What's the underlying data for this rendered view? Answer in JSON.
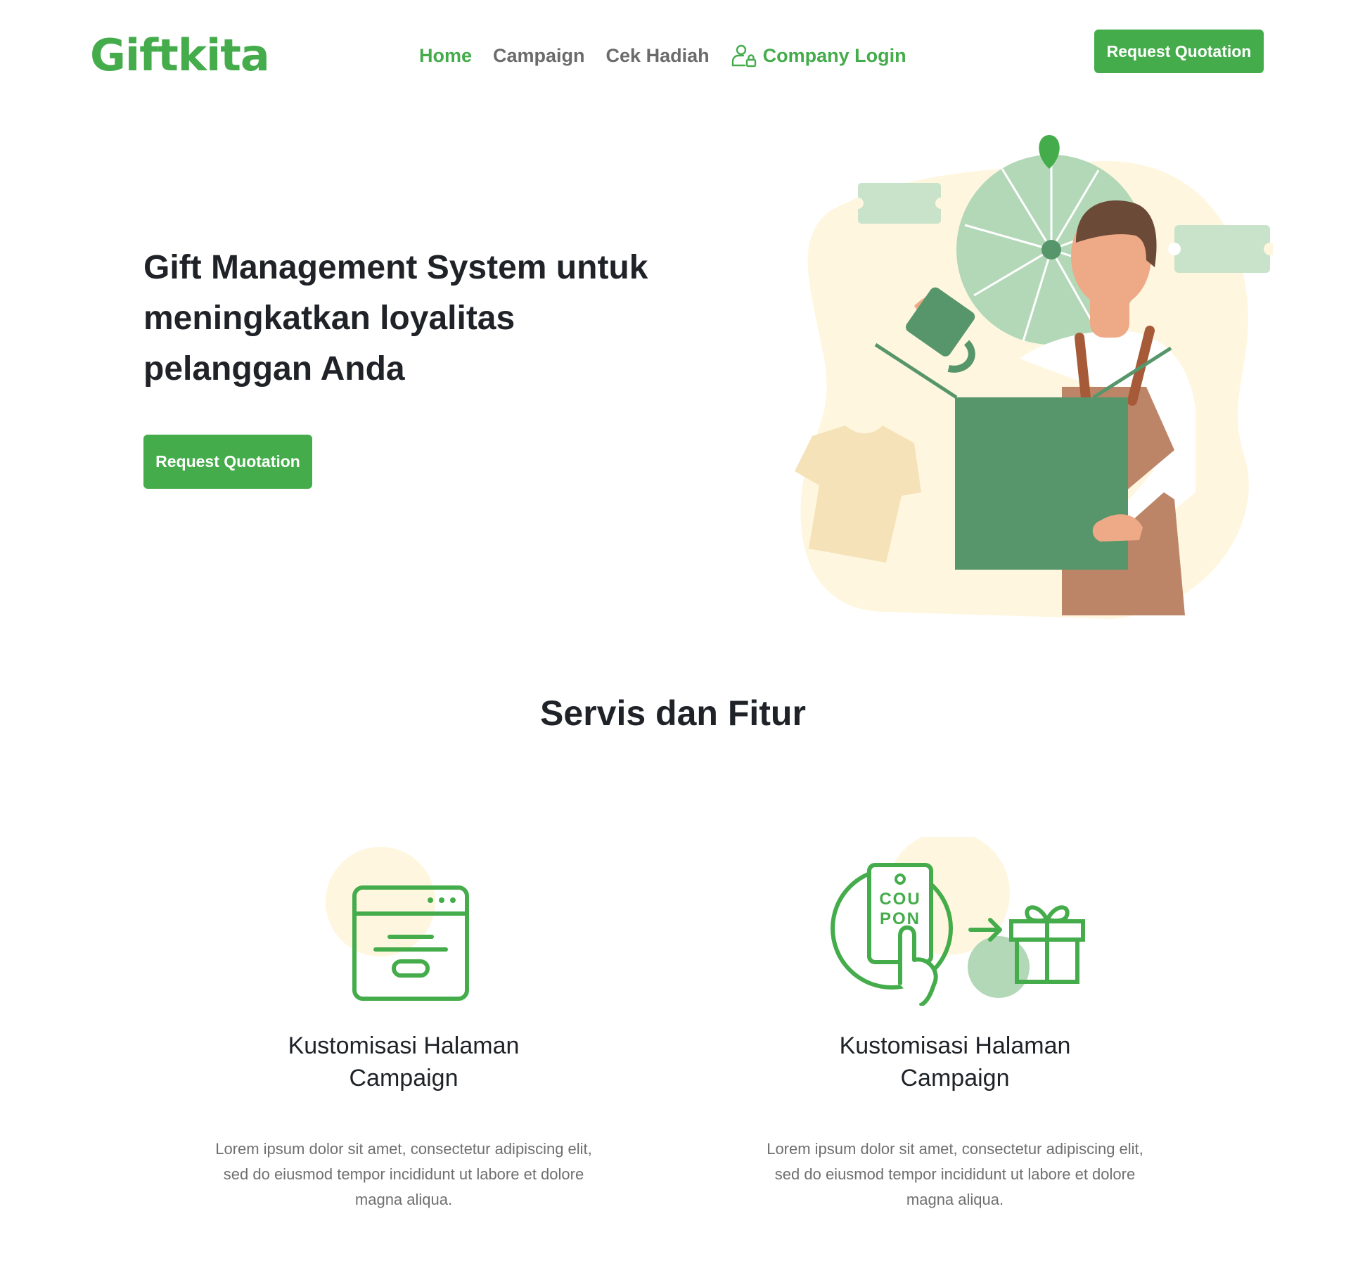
{
  "brand": {
    "name": "Giftkita"
  },
  "nav": {
    "items": [
      {
        "label": "Home",
        "active": true
      },
      {
        "label": "Campaign",
        "active": false
      },
      {
        "label": "Cek Hadiah",
        "active": false
      }
    ],
    "login_label": "Company Login",
    "login_icon": "user-lock-icon",
    "cta_label": "Request Quotation"
  },
  "hero": {
    "title": "Gift Management System untuk meningkatkan loyalitas pelanggan Anda",
    "cta_label": "Request Quotation",
    "illustration": "person-opening-gift-box-illustration"
  },
  "services": {
    "title": "Servis dan Fitur",
    "features": [
      {
        "icon": "browser-page-icon",
        "title": "Kustomisasi Halaman Campaign",
        "description": "Lorem ipsum dolor sit amet, consectetur adipiscing elit, sed do eiusmod tempor incididunt ut labore et dolore magna aliqua."
      },
      {
        "icon": "coupon-to-gift-icon",
        "title": "Kustomisasi Halaman Campaign",
        "description": "Lorem ipsum dolor sit amet, consectetur adipiscing elit, sed do eiusmod tempor incididunt ut labore et dolore magna aliqua.",
        "coupon_text_top": "COU",
        "coupon_text_bottom": "PON"
      }
    ]
  },
  "colors": {
    "brand_green": "#44ac4b",
    "dark_green": "#56966a",
    "light_green": "#b3d8b8",
    "cream": "#fff6df",
    "text_dark": "#1f2328",
    "text_muted": "#6f6f6f"
  }
}
